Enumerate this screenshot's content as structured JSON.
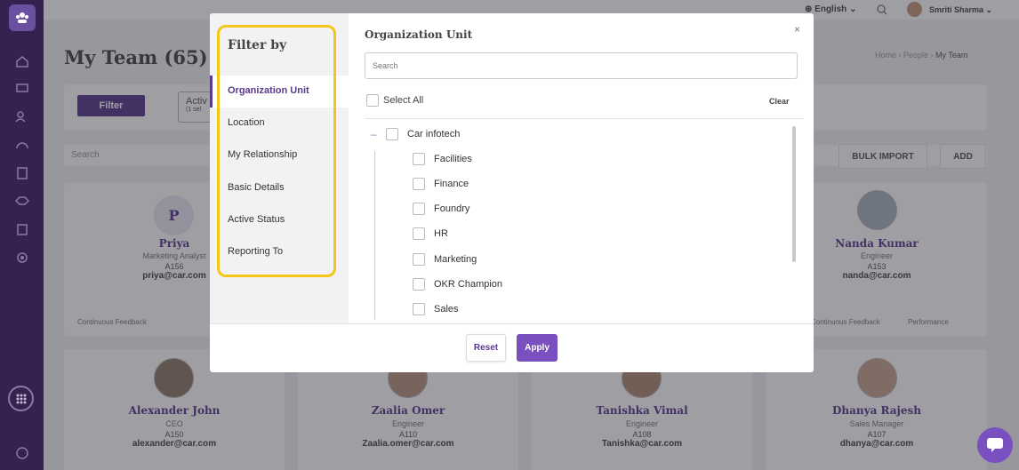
{
  "header": {
    "language": "English",
    "user_name": "Smriti Sharma"
  },
  "page": {
    "title": "My Team (65)",
    "breadcrumb": [
      "Home",
      "People",
      "My Team"
    ],
    "filter_label": "Filter",
    "active_chip": "Activ",
    "active_chip_sub": "(1 sel",
    "search_placeholder": "Search",
    "bulk_import": "BULK IMPORT",
    "add": "ADD"
  },
  "cards": [
    {
      "initial": "P",
      "name": "Priya",
      "role": "Marketing Analyst",
      "id": "A156",
      "email": "priya@car.com",
      "foot": "Continuous Feedback"
    },
    {
      "name": "Nanda Kumar",
      "role": "Engineer",
      "id": "A153",
      "email": "nanda@car.com",
      "foot_left": "Continuous Feedback",
      "foot_right": "Performance"
    },
    {
      "name": "Alexander John",
      "role": "CEO",
      "id": "A150",
      "email": "alexander@car.com"
    },
    {
      "name": "Zaalia Omer",
      "role": "Engineer",
      "id": "A110",
      "email": "Zaalia.omer@car.com"
    },
    {
      "name": "Tanishka Vimal",
      "role": "Engineer",
      "id": "A108",
      "email": "Tanishka@car.com"
    },
    {
      "name": "Dhanya Rajesh",
      "role": "Sales Manager",
      "id": "A107",
      "email": "dhanya@car.com"
    }
  ],
  "modal": {
    "sidebar_title": "Filter by",
    "sidebar_items": [
      "Organization Unit",
      "Location",
      "My Relationship",
      "Basic Details",
      "Active Status",
      "Reporting To"
    ],
    "active_item": "Organization Unit",
    "content_title": "Organization Unit",
    "search_placeholder": "Search",
    "select_all": "Select All",
    "clear": "Clear",
    "close": "×",
    "tree": {
      "parent": "Car infotech",
      "children": [
        "Facilities",
        "Finance",
        "Foundry",
        "HR",
        "Marketing",
        "OKR Champion",
        "Sales"
      ]
    },
    "reset": "Reset",
    "apply": "Apply"
  },
  "colors": {
    "accent": "#5b3a8d",
    "apply": "#7a4fc0",
    "highlight": "#f5c518",
    "rail": "#37214e"
  }
}
